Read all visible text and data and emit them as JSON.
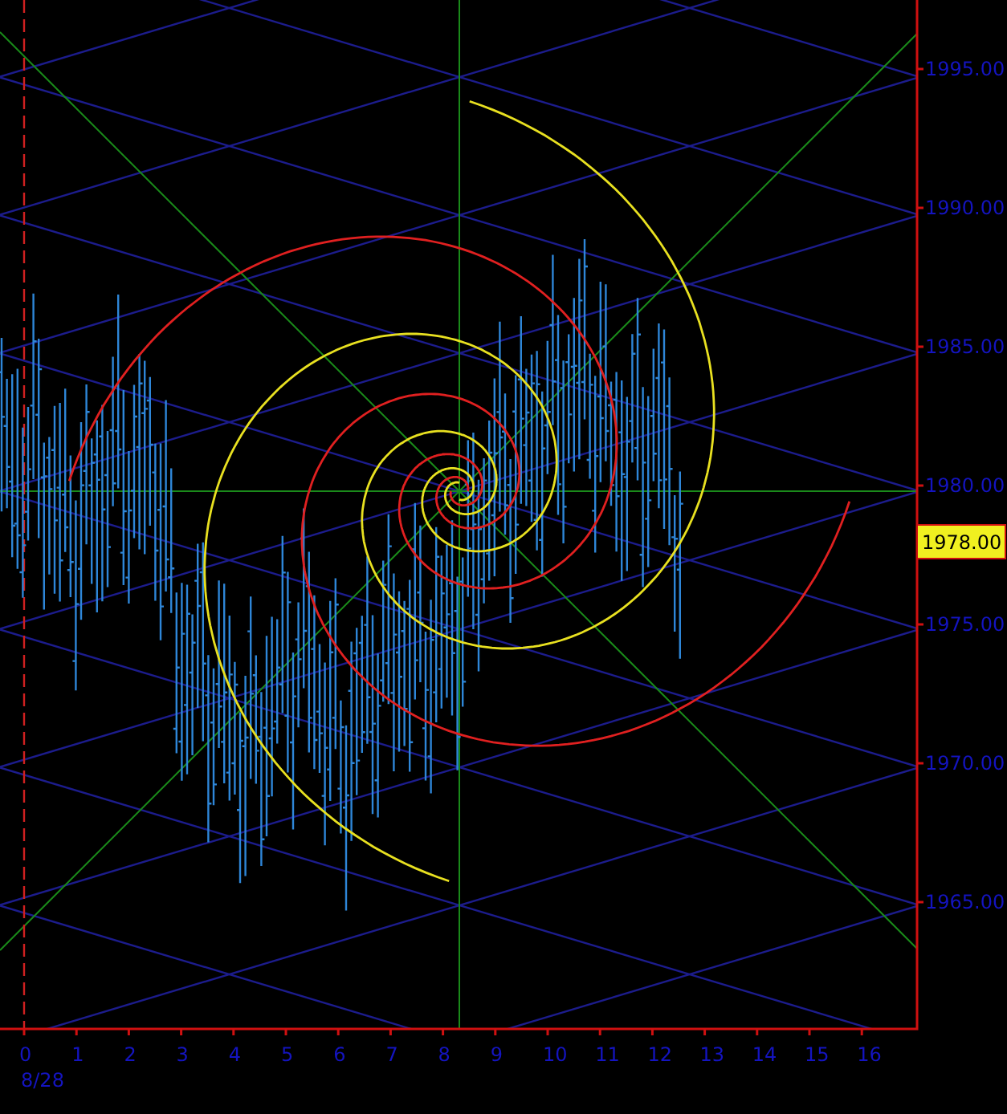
{
  "price_axis": {
    "labels": [
      "1995.00",
      "1990.00",
      "1985.00",
      "1980.00",
      "1975.00",
      "1970.00",
      "1965.00"
    ]
  },
  "current_price": "1978.00",
  "time_axis": {
    "labels": [
      "0",
      "1",
      "2",
      "3",
      "4",
      "5",
      "6",
      "7",
      "8",
      "9",
      "10",
      "11",
      "12",
      "13",
      "14",
      "15",
      "16"
    ],
    "date": "8/28"
  }
}
